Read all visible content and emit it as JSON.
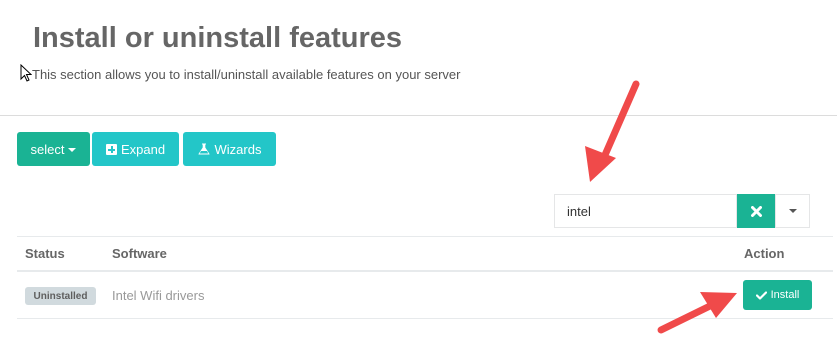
{
  "page": {
    "title": "Install or uninstall features",
    "subtitle": "This section allows you to install/uninstall available features on your server"
  },
  "toolbar": {
    "select_label": "select",
    "expand_label": "Expand",
    "wizards_label": "Wizards"
  },
  "search": {
    "value": "intel",
    "placeholder": ""
  },
  "table": {
    "headers": {
      "status": "Status",
      "software": "Software",
      "action": "Action"
    },
    "rows": [
      {
        "status": "Uninstalled",
        "software": "Intel Wifi drivers",
        "action": "Install"
      }
    ]
  },
  "colors": {
    "primary": "#1ab394",
    "info": "#23c6c8",
    "annotation_arrow": "#f04a4a",
    "badge_bg": "#d1dade"
  }
}
